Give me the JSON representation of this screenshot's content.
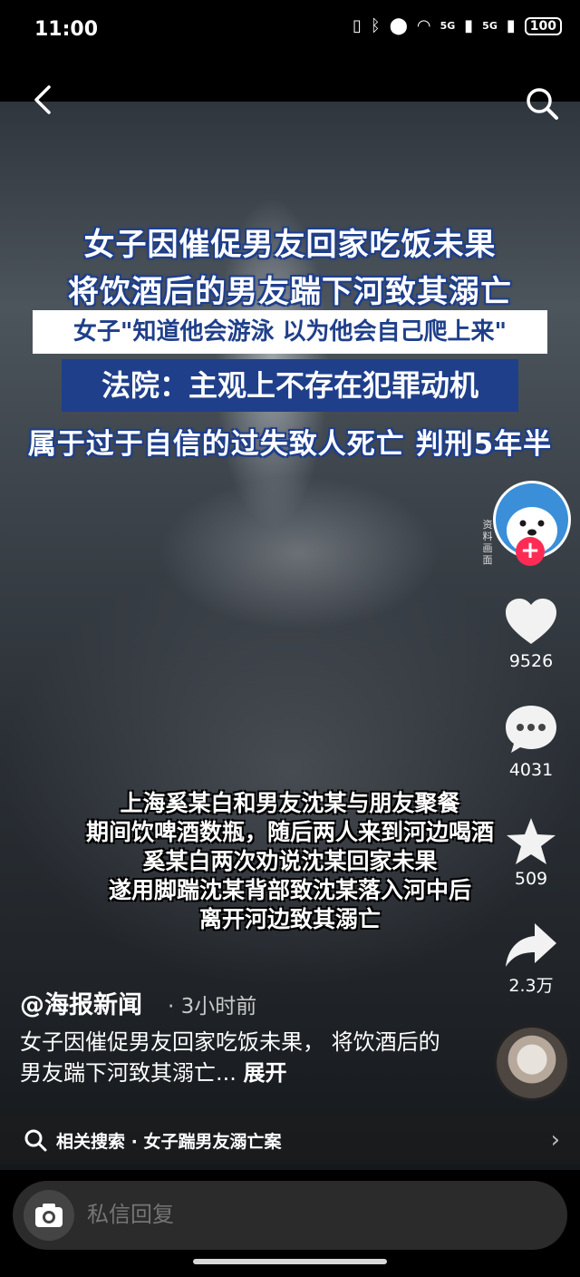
{
  "status": {
    "time": "11:00",
    "net1": "5G",
    "net2": "5G",
    "battery": "100"
  },
  "overlay": {
    "line1": "女子因催促男友回家吃饭未果",
    "line2": "将饮酒后的男友踹下河致其溺亡",
    "line3": "女子\"知道他会游泳 以为他会自己爬上来\"",
    "line4": "法院：主观上不存在犯罪动机",
    "line5": "属于过于自信的过失致人死亡 判刑5年半"
  },
  "subtitles": [
    "上海奚某白和男友沈某与朋友聚餐",
    "期间饮啤酒数瓶，随后两人来到河边喝酒",
    "奚某白两次劝说沈某回家未果",
    "遂用脚踹沈某背部致沈某落入河中后",
    "离开河边致其溺亡"
  ],
  "side": {
    "material_label": "资料画面",
    "likes": "9526",
    "comments": "4031",
    "favorites": "509",
    "shares": "2.3万"
  },
  "post": {
    "author": "@海报新闻",
    "time_ago": "· 3小时前",
    "desc": "女子因催促男友回家吃饭未果， 将饮酒后的男友踹下河致其溺亡...",
    "expand": "展开"
  },
  "related": {
    "label": "相关搜索 · 女子踹男友溺亡案"
  },
  "input": {
    "placeholder": "私信回复"
  },
  "icons": {
    "back": "back-arrow-icon",
    "search": "search-icon",
    "like": "heart-icon",
    "comment": "comment-icon",
    "favorite": "star-icon",
    "share": "share-icon",
    "camera": "camera-icon"
  }
}
